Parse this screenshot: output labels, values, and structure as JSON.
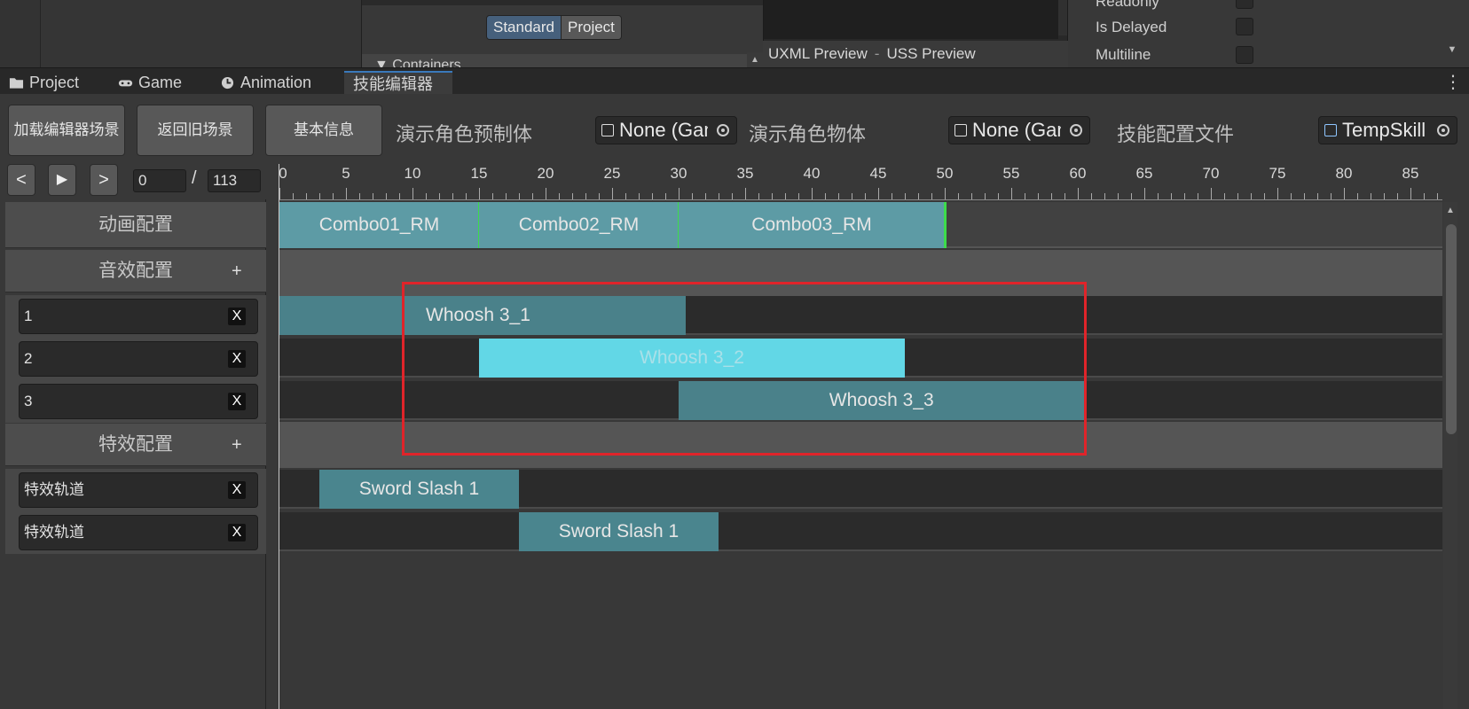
{
  "top": {
    "segmented": {
      "standard": "Standard",
      "project": "Project"
    },
    "containers_label": "Containers",
    "uxml_preview": "UXML Preview",
    "separator": "-",
    "uss_preview": "USS Preview",
    "inspector_rows": [
      "Readonly",
      "Is Delayed",
      "Multiline"
    ]
  },
  "tabs": [
    {
      "label": "Project",
      "icon": "folder-icon"
    },
    {
      "label": "Game",
      "icon": "gamepad-icon"
    },
    {
      "label": "Animation",
      "icon": "clock-icon"
    },
    {
      "label": "技能编辑器",
      "icon": ""
    }
  ],
  "toolbar": {
    "load_scene": "加载编辑器场景",
    "return_scene": "返回旧场景",
    "basic_info": "基本信息",
    "preview_prefab_label": "演示角色预制体",
    "preview_prefab_value": "None (Game Object)",
    "preview_object_label": "演示角色物体",
    "preview_object_value": "None (Game Object)",
    "skill_config_label": "技能配置文件",
    "skill_config_value": "TempSkill"
  },
  "playback": {
    "prev": "<",
    "play": "▶",
    "next": ">",
    "current_frame": "0",
    "slash": "/",
    "total_frames": "113"
  },
  "ruler": {
    "labels": [
      "0",
      "5",
      "10",
      "15",
      "20",
      "25",
      "30",
      "35",
      "40",
      "45",
      "50",
      "55",
      "60",
      "65",
      "70",
      "75",
      "80",
      "85"
    ]
  },
  "sections": {
    "animation": "动画配置",
    "audio": "音效配置",
    "effect": "特效配置",
    "plus": "+"
  },
  "audio_tracks": [
    {
      "name": "1"
    },
    {
      "name": "2"
    },
    {
      "name": "3"
    }
  ],
  "effect_tracks": [
    {
      "name": "特效轨道"
    },
    {
      "name": "特效轨道"
    }
  ],
  "delete_label": "X",
  "animation_clips": [
    {
      "name": "Combo01_RM",
      "start": 0,
      "end": 15
    },
    {
      "name": "Combo02_RM",
      "start": 15,
      "end": 30
    },
    {
      "name": "Combo03_RM",
      "start": 30,
      "end": 50
    }
  ],
  "audio_clips": [
    {
      "name": "Whoosh 3_1",
      "start": 0,
      "end": 30.5
    },
    {
      "name": "Whoosh 3_2",
      "start": 15,
      "end": 47
    },
    {
      "name": "Whoosh 3_3",
      "start": 30,
      "end": 60.5
    }
  ],
  "effect_clips": [
    {
      "name": "Sword Slash 1",
      "start": 3,
      "end": 18
    },
    {
      "name": "Sword Slash 1",
      "start": 18,
      "end": 33
    }
  ],
  "colors": {
    "anim_clip": "#5d9ba5",
    "audio_clip": "#4a818a",
    "audio_clip_selected": "#62d7e6",
    "effect_clip": "#4a858e",
    "frame_marker": "#3ddc4a",
    "highlight_box": "#e0242a"
  }
}
